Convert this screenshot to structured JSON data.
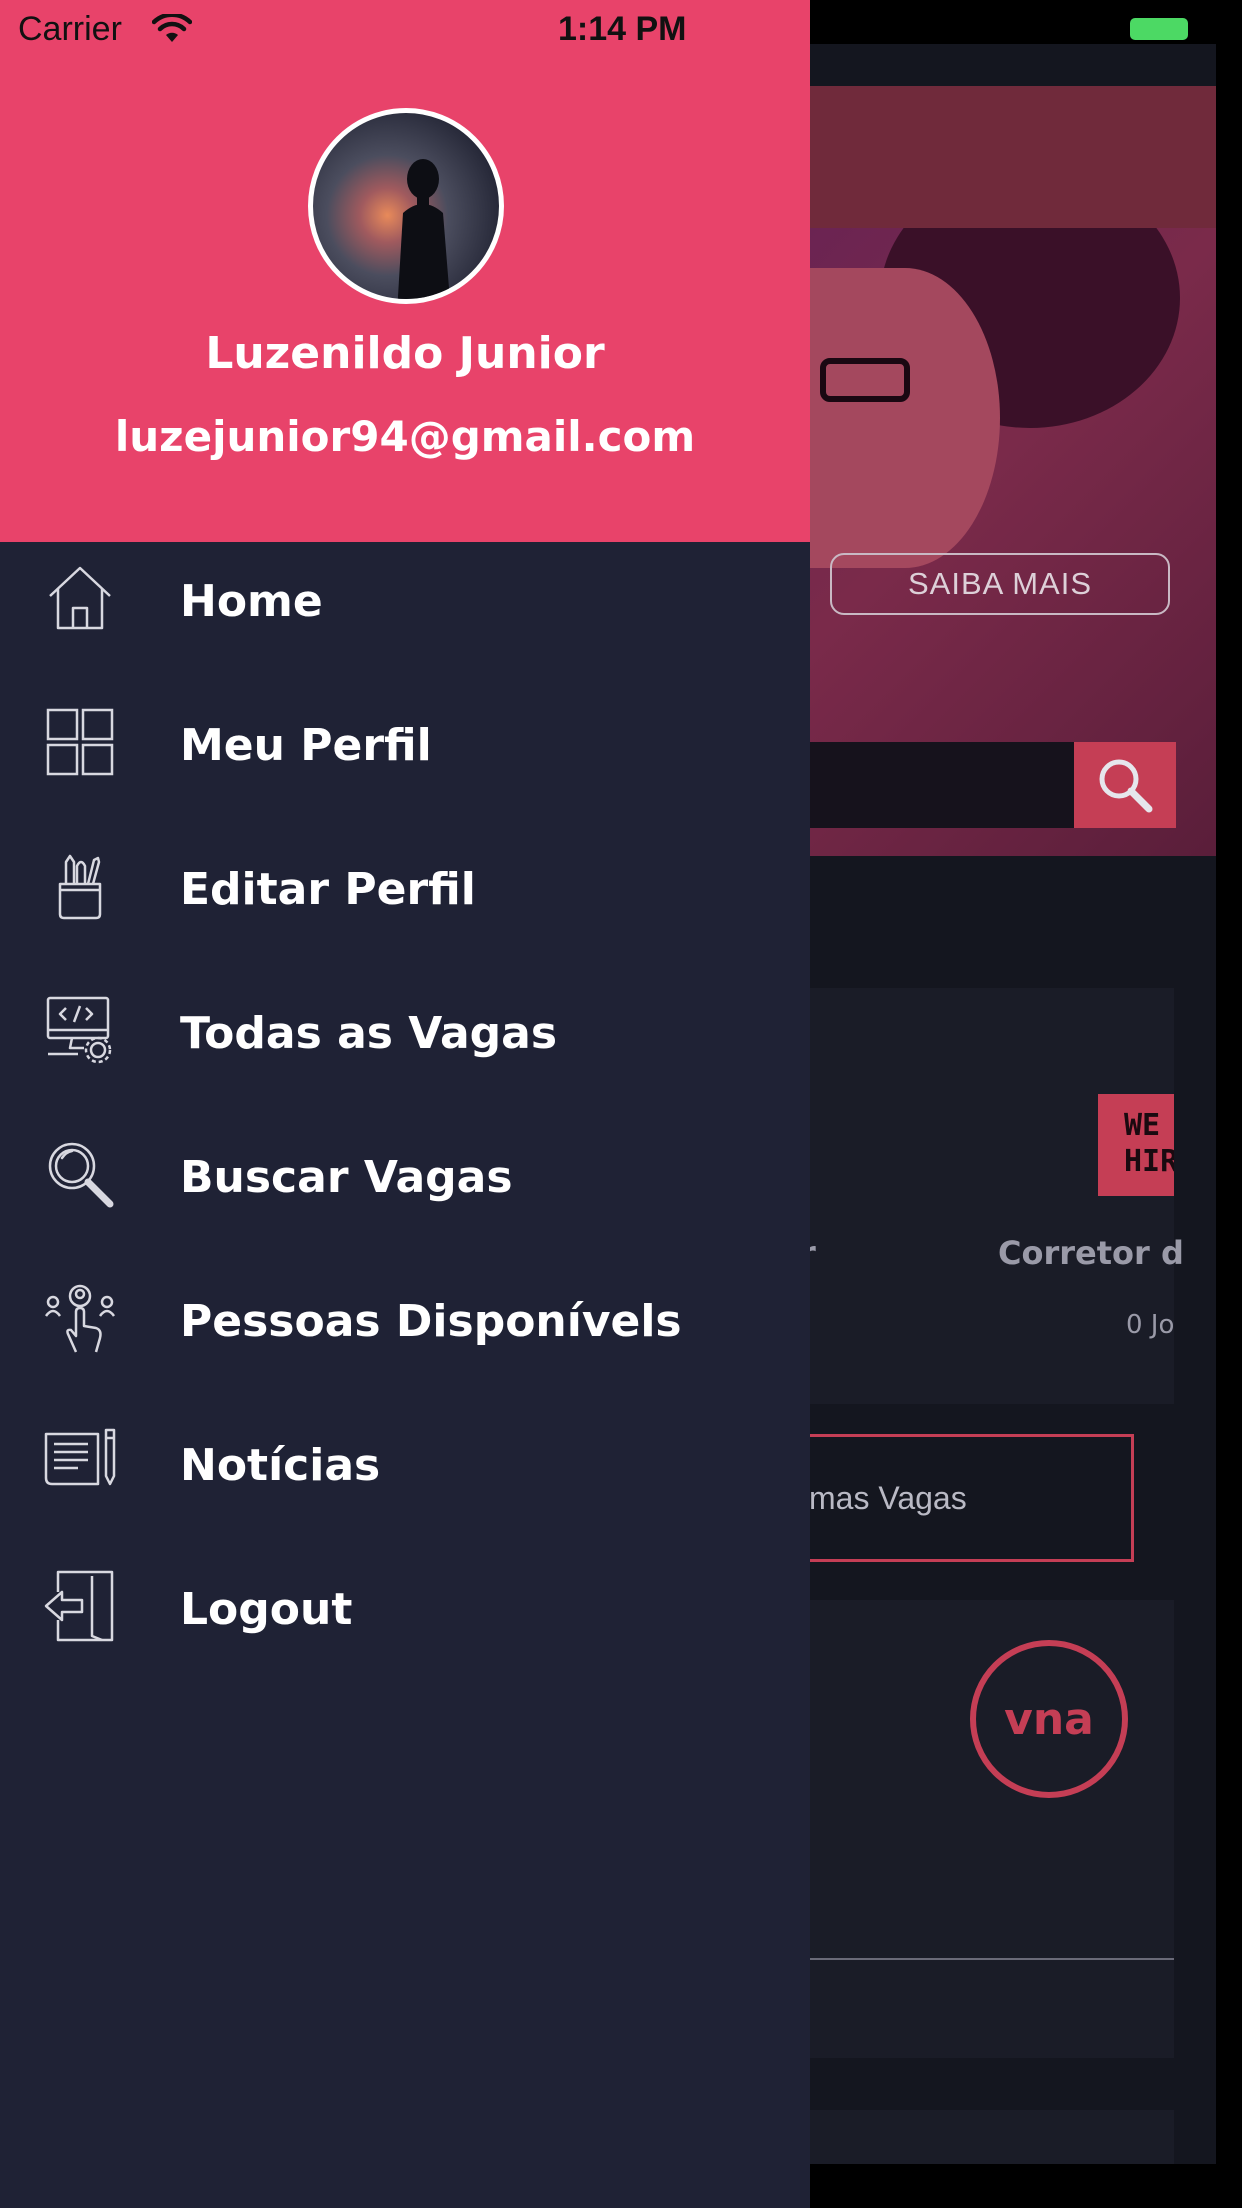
{
  "status_bar": {
    "carrier": "Carrier",
    "time": "1:14 PM"
  },
  "colors": {
    "accent": "#e8436a",
    "drawer_bg": "#1f2235",
    "text": "#ffffff"
  },
  "profile": {
    "name": "Luzenildo Junior",
    "email": "luzejunior94@gmail.com"
  },
  "menu": {
    "items": [
      {
        "label": "Home",
        "icon": "home-icon"
      },
      {
        "label": "Meu Perfil",
        "icon": "grid-icon"
      },
      {
        "label": "Editar Perfil",
        "icon": "pencil-cup-icon"
      },
      {
        "label": "Todas as Vagas",
        "icon": "computer-code-icon"
      },
      {
        "label": "Buscar Vagas",
        "icon": "search-icon"
      },
      {
        "label": "Pessoas Disponívels",
        "icon": "people-touch-icon"
      },
      {
        "label": "Notícias",
        "icon": "news-icon"
      },
      {
        "label": "Logout",
        "icon": "logout-icon"
      }
    ]
  },
  "background": {
    "hero_button": "SAIBA MAIS",
    "card_title_left": "r",
    "card_title": "Corretor d",
    "card_subtitle": "0 Jo",
    "hiring_sign": "WE HIR",
    "outline_button": "timas Vagas",
    "logo_text": "vna"
  }
}
